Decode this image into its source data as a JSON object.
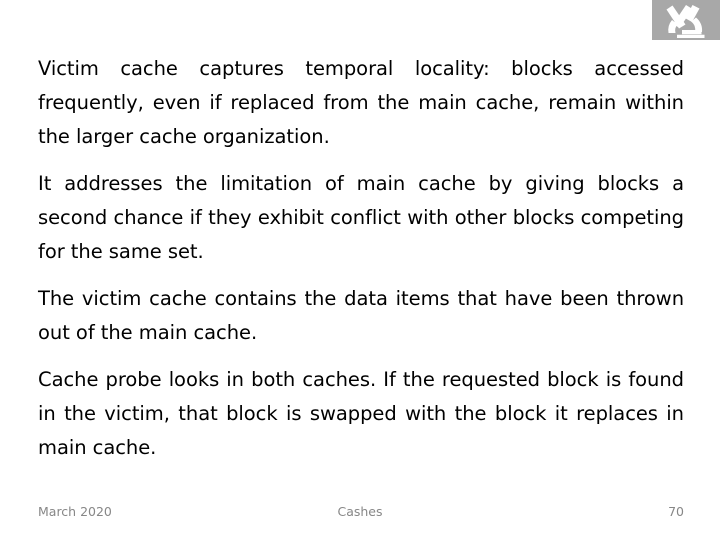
{
  "slide": {
    "logo": {
      "icon_name": "microscope-logo-icon",
      "background_color": "#a8a8a8",
      "mark_color": "#ffffff"
    },
    "paragraphs": [
      {
        "id": "p1",
        "text": "Victim cache captures temporal locality: blocks accessed frequently, even if replaced from the main cache, remain within the larger cache organization."
      },
      {
        "id": "p2",
        "text": "It addresses the limitation of main cache by giving blocks a second chance if they exhibit conflict with other blocks competing for the same set."
      },
      {
        "id": "p3",
        "text": "The victim cache contains the data items that have been thrown out of the main cache."
      },
      {
        "id": "p4",
        "text": "Cache probe looks in both caches. If the requested block is found in the victim, that block is swapped with the block it replaces in main cache."
      }
    ],
    "footer": {
      "date": "March 2020",
      "title": "Cashes",
      "page_number": "70",
      "text_color": "#878787"
    }
  }
}
